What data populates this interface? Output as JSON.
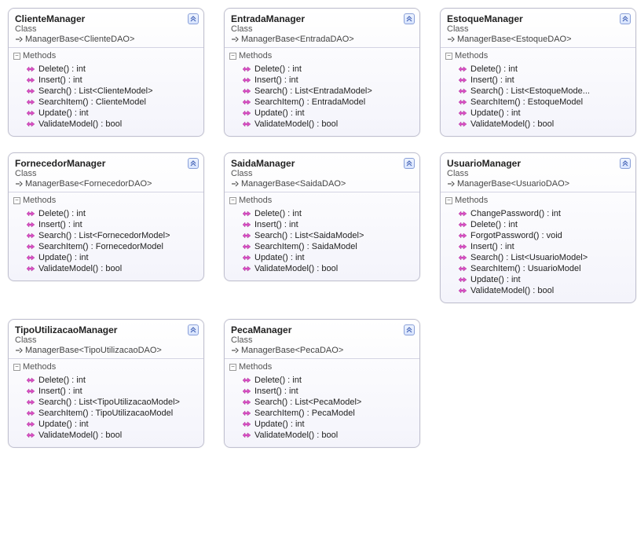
{
  "labels": {
    "classKind": "Class",
    "methodsHeader": "Methods",
    "inheritPrefix": "ManagerBase"
  },
  "classes": [
    {
      "name": "ClienteManager",
      "dao": "ClienteDAO",
      "row": 1,
      "col": 1,
      "methods": [
        "Delete() : int",
        "Insert() : int",
        "Search() : List<ClienteModel>",
        "SearchItem() : ClienteModel",
        "Update() : int",
        "ValidateModel() : bool"
      ]
    },
    {
      "name": "EntradaManager",
      "dao": "EntradaDAO",
      "row": 1,
      "col": 2,
      "methods": [
        "Delete() : int",
        "Insert() : int",
        "Search() : List<EntradaModel>",
        "SearchItem() : EntradaModel",
        "Update() : int",
        "ValidateModel() : bool"
      ]
    },
    {
      "name": "EstoqueManager",
      "dao": "EstoqueDAO",
      "row": 1,
      "col": 3,
      "methods": [
        "Delete() : int",
        "Insert() : int",
        "Search() : List<EstoqueMode...",
        "SearchItem() : EstoqueModel",
        "Update() : int",
        "ValidateModel() : bool"
      ]
    },
    {
      "name": "FornecedorManager",
      "dao": "FornecedorDAO",
      "row": 2,
      "col": 1,
      "methods": [
        "Delete() : int",
        "Insert() : int",
        "Search() : List<FornecedorModel>",
        "SearchItem() : FornecedorModel",
        "Update() : int",
        "ValidateModel() : bool"
      ]
    },
    {
      "name": "SaidaManager",
      "dao": "SaidaDAO",
      "row": 2,
      "col": 2,
      "methods": [
        "Delete() : int",
        "Insert() : int",
        "Search() : List<SaidaModel>",
        "SearchItem() : SaidaModel",
        "Update() : int",
        "ValidateModel() : bool"
      ]
    },
    {
      "name": "UsuarioManager",
      "dao": "UsuarioDAO",
      "row": 2,
      "col": 3,
      "methods": [
        "ChangePassword() : int",
        "Delete() : int",
        "ForgotPassword() : void",
        "Insert() : int",
        "Search() : List<UsuarioModel>",
        "SearchItem() : UsuarioModel",
        "Update() : int",
        "ValidateModel() : bool"
      ]
    },
    {
      "name": "TipoUtilizacaoManager",
      "dao": "TipoUtilizacaoDAO",
      "row": 3,
      "col": 1,
      "methods": [
        "Delete() : int",
        "Insert() : int",
        "Search() : List<TipoUtilizacaoModel>",
        "SearchItem() : TipoUtilizacaoModel",
        "Update() : int",
        "ValidateModel() : bool"
      ]
    },
    {
      "name": "PecaManager",
      "dao": "PecaDAO",
      "row": 3,
      "col": 2,
      "methods": [
        "Delete() : int",
        "Insert() : int",
        "Search() : List<PecaModel>",
        "SearchItem() : PecaModel",
        "Update() : int",
        "ValidateModel() : bool"
      ]
    }
  ]
}
